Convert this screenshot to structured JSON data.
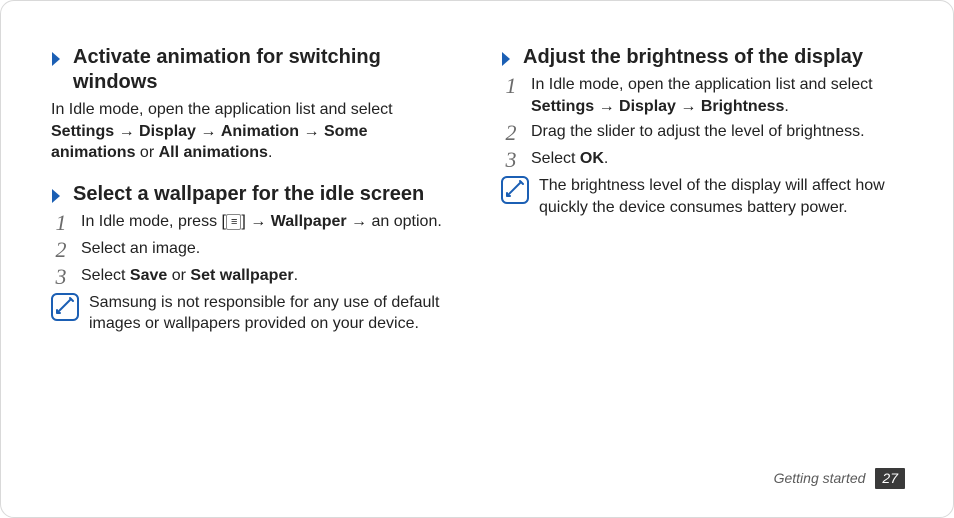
{
  "left": {
    "sec1": {
      "title": "Activate animation for switching windows",
      "p1a": "In Idle mode, open the application list and select ",
      "settings": "Settings",
      "arrow": " → ",
      "display": "Display",
      "animation": "Animation",
      "some": "Some animations",
      "or": " or ",
      "all": "All animations",
      "period": "."
    },
    "sec2": {
      "title": "Select a wallpaper for the idle screen",
      "s1a": "In Idle mode, press [",
      "s1b": "] → ",
      "wallpaper": "Wallpaper",
      "s1c": " → an option.",
      "s2": "Select an image.",
      "s3a": "Select ",
      "save": "Save",
      "s3b": " or ",
      "setwp": "Set wallpaper",
      "s3c": ".",
      "note": "Samsung is not responsible for any use of default images or wallpapers provided on your device."
    }
  },
  "right": {
    "sec1": {
      "title": "Adjust the brightness of the display",
      "s1a": "In Idle mode, open the application list and select ",
      "settings": "Settings",
      "arrow": " → ",
      "display": "Display",
      "brightness": "Brightness",
      "s1b": ".",
      "s2": "Drag the slider to adjust the level of brightness.",
      "s3a": "Select ",
      "ok": "OK",
      "s3b": ".",
      "note": "The brightness level of the display will affect how quickly the device consumes battery power."
    }
  },
  "nums": {
    "one": "1",
    "two": "2",
    "three": "3"
  },
  "menuGlyph": "≡",
  "footer": {
    "section": "Getting started",
    "page": "27"
  }
}
